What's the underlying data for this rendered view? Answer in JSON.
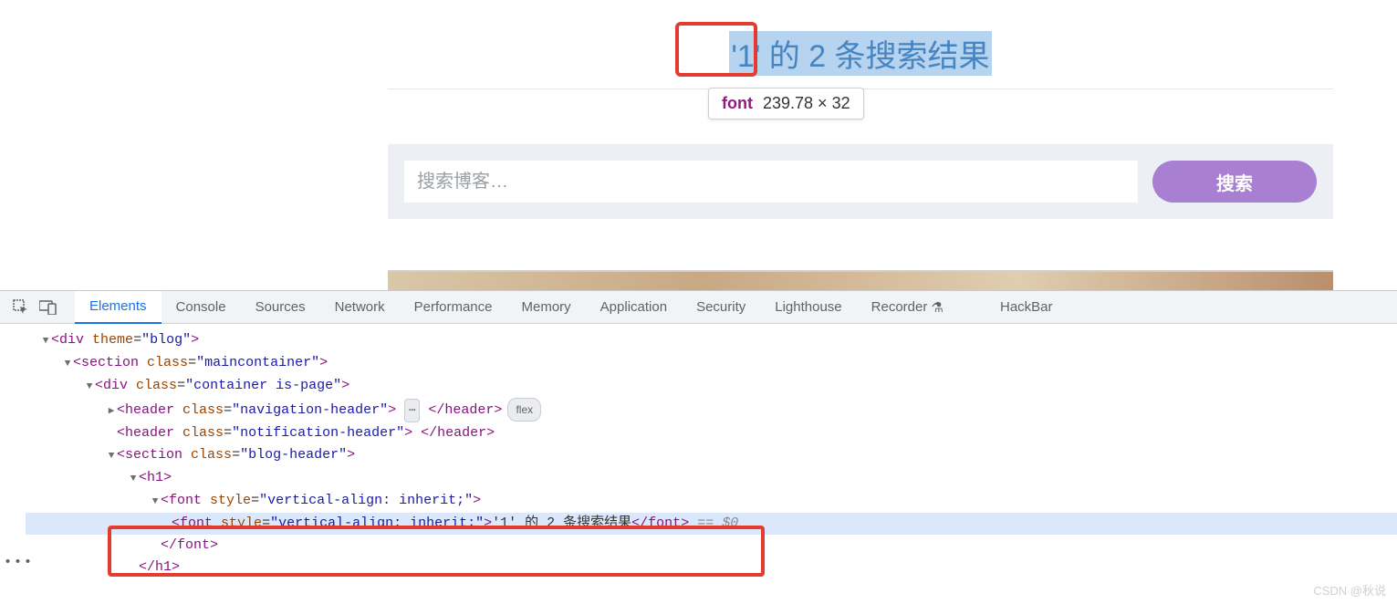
{
  "page": {
    "heading_text": "'1' 的 2 条搜索结果",
    "search_placeholder": "搜索博客…",
    "search_button": "搜索"
  },
  "tooltip": {
    "label": "font",
    "dims": "239.78 × 32"
  },
  "devtools": {
    "tabs": [
      "Elements",
      "Console",
      "Sources",
      "Network",
      "Performance",
      "Memory",
      "Application",
      "Security",
      "Lighthouse",
      "Recorder",
      "HackBar"
    ],
    "active_tab": "Elements"
  },
  "dom": {
    "l0_frag": "…",
    "l1_open": "<div theme=\"blog\">",
    "l2_open": "<section class=\"maincontainer\">",
    "l3_open": "<div class=\"container is-page\">",
    "l4_nav": "<header class=\"navigation-header\">",
    "l4_nav_close": "</header>",
    "l4_nav_pill": "flex",
    "l5_notif": "<header class=\"notification-header\"> </header>",
    "l6_open": "<section class=\"blog-header\">",
    "l7_open": "<h1>",
    "l8_open": "<font style=\"vertical-align: inherit;\">",
    "l9_full": "<font style=\"vertical-align: inherit;\">'1' 的 2 条搜索结果</font>",
    "l9_marker": "== $0",
    "l10_close": "</font>",
    "l11_close": "</h1>"
  },
  "watermark": "CSDN @秋说"
}
